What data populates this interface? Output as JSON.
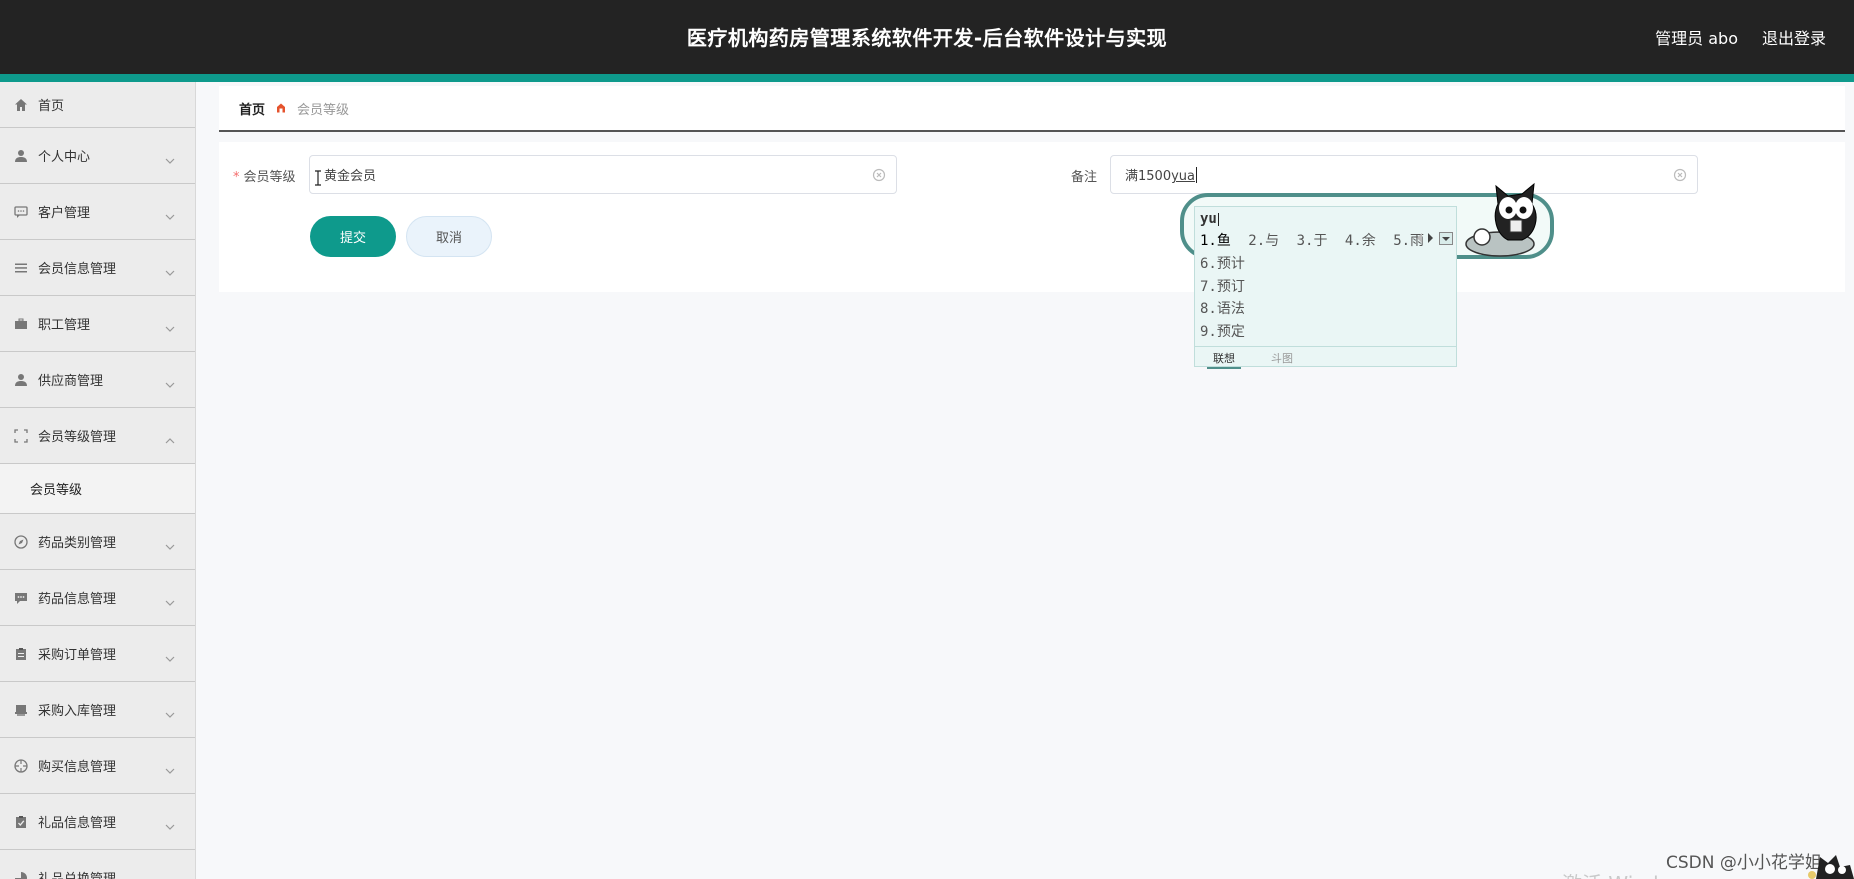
{
  "header": {
    "title": "医疗机构药房管理系统软件开发-后台软件设计与实现",
    "user_label": "管理员 abo",
    "logout_label": "退出登录"
  },
  "sidebar": {
    "items": [
      {
        "label": "首页",
        "icon": "home-icon"
      },
      {
        "label": "个人中心",
        "icon": "user-icon"
      },
      {
        "label": "客户管理",
        "icon": "chat-icon"
      },
      {
        "label": "会员信息管理",
        "icon": "list-icon"
      },
      {
        "label": "职工管理",
        "icon": "briefcase-icon"
      },
      {
        "label": "供应商管理",
        "icon": "user-icon"
      },
      {
        "label": "会员等级管理",
        "icon": "fullscreen-icon",
        "expanded": true,
        "children": [
          "会员等级"
        ]
      },
      {
        "label": "药品类别管理",
        "icon": "compass-icon"
      },
      {
        "label": "药品信息管理",
        "icon": "message-icon"
      },
      {
        "label": "采购订单管理",
        "icon": "clipboard-icon"
      },
      {
        "label": "采购入库管理",
        "icon": "stamp-icon"
      },
      {
        "label": "购买信息管理",
        "icon": "aperture-icon"
      },
      {
        "label": "礼品信息管理",
        "icon": "clipboard-check-icon"
      },
      {
        "label": "礼品兑换管理",
        "icon": "pie-icon"
      }
    ]
  },
  "breadcrumb": {
    "home": "首页",
    "current": "会员等级"
  },
  "form": {
    "level_label": "会员等级",
    "level_value": "黄金会员",
    "remark_label": "备注",
    "remark_value_prefix": "满1500",
    "remark_value_composing": "yua",
    "submit_label": "提交",
    "cancel_label": "取消"
  },
  "ime": {
    "pinyin": "yu",
    "row1": [
      "1.鱼",
      "2.与",
      "3.于",
      "4.余",
      "5.雨"
    ],
    "list": [
      "6.预计",
      "7.预订",
      "8.语法",
      "9.预定"
    ],
    "tabs": [
      "联想",
      "斗图"
    ]
  },
  "watermark": "CSDN @小小花学姐",
  "activate_text": "激活 Windows",
  "colors": {
    "header_bg": "#232323",
    "accent": "#0e9a8c"
  }
}
